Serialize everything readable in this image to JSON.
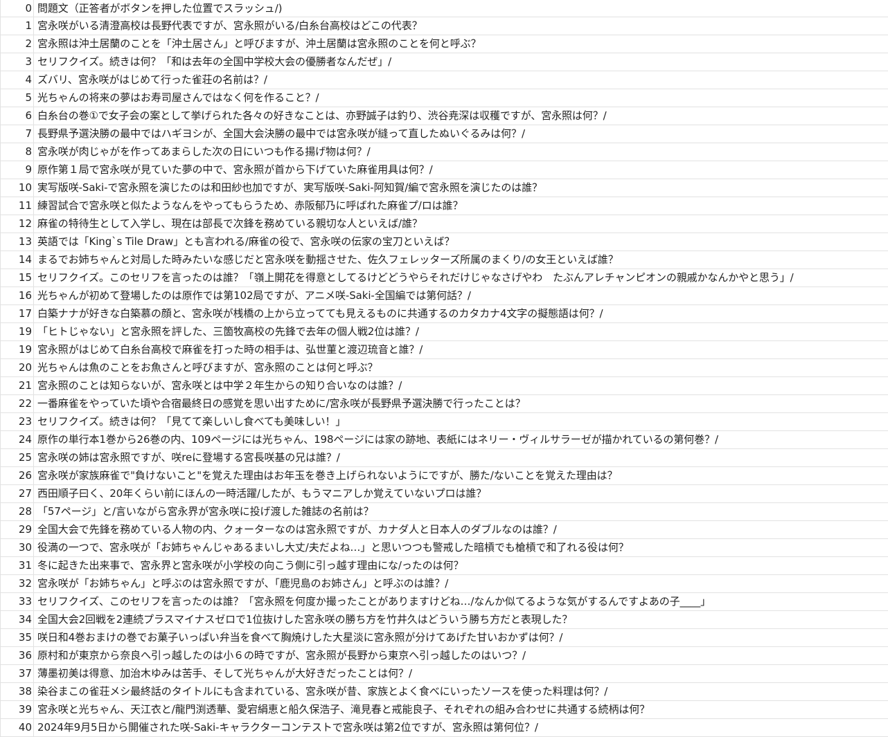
{
  "rows": [
    {
      "idx": "0",
      "text": "問題文（正答者がボタンを押した位置でスラッシュ/)"
    },
    {
      "idx": "1",
      "text": "宮永咲がいる清澄高校は長野代表ですが、宮永照がいる/白糸台高校はどこの代表？"
    },
    {
      "idx": "2",
      "text": "宮永照は沖土居蘭のことを「沖土居さん」と呼びますが、沖土居蘭は宮永照のことを何と呼ぶ？"
    },
    {
      "idx": "3",
      "text": "セリフクイズ。続きは何？「和は去年の全国中学校大会の優勝者なんだぜ」/"
    },
    {
      "idx": "4",
      "text": "ズバリ、宮永咲がはじめて行った雀荘の名前は？/"
    },
    {
      "idx": "5",
      "text": "光ちゃんの将来の夢はお寿司屋さんではなく何を作ること？/"
    },
    {
      "idx": "6",
      "text": "白糸台の巻①で女子会の案として挙げられた各々の好きなことは、亦野誠子は釣り、渋谷尭深は収穫ですが、宮永照は何？/"
    },
    {
      "idx": "7",
      "text": "長野県予選決勝の最中ではハギヨシが、全国大会決勝の最中では宮永咲が縫って直したぬいぐるみは何？/"
    },
    {
      "idx": "8",
      "text": "宮永咲が肉じゃがを作ってあまらした次の日にいつも作る揚げ物は何？/"
    },
    {
      "idx": "9",
      "text": "原作第１局で宮永咲が見ていた夢の中で、宮永照が首から下げていた麻雀用具は何？/"
    },
    {
      "idx": "10",
      "text": "実写版咲-Saki-で宮永照を演じたのは和田紗也加ですが、実写版咲-Saki-阿知賀/編で宮永照を演じたのは誰？"
    },
    {
      "idx": "11",
      "text": "練習試合で宮永咲と似たようなんをやってもらうため、赤阪郁乃に呼ばれた麻雀プ/ロは誰？"
    },
    {
      "idx": "12",
      "text": "麻雀の特待生として入学し、現在は部長で次鋒を務めている親切な人といえば/誰？"
    },
    {
      "idx": "13",
      "text": "英語では「King`s Tile Draw」とも言われる/麻雀の役で、宮永咲の伝家の宝刀といえば？"
    },
    {
      "idx": "14",
      "text": "まるでお姉ちゃんと対局した時みたいな感じだと宮永咲を動揺させた、佐久フェレッターズ所属のまくり/の女王といえば誰？"
    },
    {
      "idx": "15",
      "text": "セリフクイズ。このセリフを言ったのは誰？「嶺上開花を得意としてるけどどうやらそれだけじゃなさげやわ　たぶんアレチャンピオンの親戚かなんかやと思う」/"
    },
    {
      "idx": "16",
      "text": "光ちゃんが初めて登場したのは原作では第102局ですが、アニメ咲-Saki-全国編では第何話？/"
    },
    {
      "idx": "17",
      "text": "白築ナナが好きな白築慕の顔と、宮永咲が桟橋の上から立ってても見えるものに共通するのカタカナ4文字の擬態語は何？/"
    },
    {
      "idx": "19",
      "text": "「ヒトじゃない」と宮永照を評した、三箇牧高校の先鋒で去年の個人戦2位は誰？/"
    },
    {
      "idx": "19",
      "text": "宮永照がはじめて白糸台高校で麻雀を打った時の相手は、弘世菫と渡辺琉音と誰？/"
    },
    {
      "idx": "20",
      "text": "光ちゃんは魚のことをお魚さんと呼びますが、宮永照のことは何と呼ぶ？"
    },
    {
      "idx": "21",
      "text": "宮永照のことは知らないが、宮永咲とは中学２年生からの知り合いなのは誰？/"
    },
    {
      "idx": "22",
      "text": "一番麻雀をやっていた頃や合宿最終日の感覚を思い出すために/宮永咲が長野県予選決勝で行ったことは？"
    },
    {
      "idx": "23",
      "text": "セリフクイズ。続きは何？「見てて楽しいし食べても美味しい！」"
    },
    {
      "idx": "24",
      "text": "原作の単行本1巻から26巻の内、109ページには光ちゃん、198ページには家の跡地、表紙にはネリー・ヴィルサラーゼが描かれているの第何巻？/"
    },
    {
      "idx": "25",
      "text": "宮永咲の姉は宮永照ですが、咲reに登場する宮長咲基の兄は誰？/"
    },
    {
      "idx": "26",
      "text": "宮永咲が家族麻雀で\"負けないこと\"を覚えた理由はお年玉を巻き上げられないようにですが、勝た/ないことを覚えた理由は？"
    },
    {
      "idx": "27",
      "text": "西田順子曰く、20年くらい前にほんの一時活躍/したが、もうマニアしか覚えていないプロは誰？"
    },
    {
      "idx": "28",
      "text": "「57ページ」と/言いながら宮永界が宮永咲に投げ渡した雑誌の名前は？"
    },
    {
      "idx": "29",
      "text": "全国大会で先鋒を務めている人物の内、クォーターなのは宮永照ですが、カナダ人と日本人のダブルなのは誰？/"
    },
    {
      "idx": "30",
      "text": "役満の一つで、宮永咲が「お姉ちゃんじゃあるまいし大丈/夫だよね…」と思いつつも警戒した暗槓でも槍槓で和了れる役は何？"
    },
    {
      "idx": "31",
      "text": "冬に起きた出来事で、宮永界と宮永咲が小学校の向こう側に引っ越す理由にな/ったのは何？"
    },
    {
      "idx": "32",
      "text": "宮永咲が「お姉ちゃん」と呼ぶのは宮永照ですが、「鹿児島のお姉さん」と呼ぶのは誰？/"
    },
    {
      "idx": "33",
      "text": "セリフクイズ、このセリフを言ったのは誰？「宮永照を何度か撮ったことがありますけどね…/なんか似てるような気がするんですよあの子____」"
    },
    {
      "idx": "34",
      "text": "全国大会2回戦を2連続プラスマイナスゼロで1位抜けした宮永咲の勝ち方を竹井久はどういう勝ち方だと表現した？"
    },
    {
      "idx": "35",
      "text": "咲日和4巻おまけの巻でお菓子いっぱい弁当を食べて胸焼けした大星淡に宮永照が分けてあげた甘いおかずは何？/"
    },
    {
      "idx": "36",
      "text": "原村和が東京から奈良へ引っ越したのは小６の時ですが、宮永照が長野から東京へ引っ越したのはいつ？/"
    },
    {
      "idx": "37",
      "text": "薄墨初美は得意、加治木ゆみは苦手、そして光ちゃんが大好きだったことは何？/"
    },
    {
      "idx": "38",
      "text": "染谷まこの雀荘メシ最終話のタイトルにも含まれている、宮永咲が昔、家族とよく食べにいったソースを使った料理は何？/"
    },
    {
      "idx": "39",
      "text": "宮永咲と光ちゃん、天江衣と/龍門渕透華、愛宕絹恵と船久保浩子、滝見春と戒能良子、それぞれの組み合わせに共通する続柄は何？"
    },
    {
      "idx": "40",
      "text": "2024年9月5日から開催された咲-Saki-キャラクターコンテストで宮永咲は第2位ですが、宮永照は第何位？/"
    }
  ]
}
